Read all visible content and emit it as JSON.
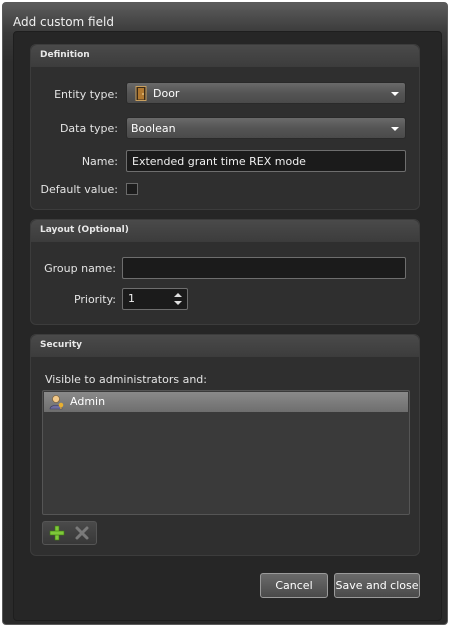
{
  "window": {
    "title": "Add custom field"
  },
  "definition": {
    "header": "Definition",
    "entity_type": {
      "label": "Entity type:",
      "value": "Door",
      "icon": "door-icon"
    },
    "data_type": {
      "label": "Data type:",
      "value": "Boolean"
    },
    "name": {
      "label": "Name:",
      "value": "Extended grant time REX mode"
    },
    "default_value": {
      "label": "Default value:",
      "checked": false
    }
  },
  "layout": {
    "header": "Layout (Optional)",
    "group_name": {
      "label": "Group name:",
      "value": ""
    },
    "priority": {
      "label": "Priority:",
      "value": "1"
    }
  },
  "security": {
    "header": "Security",
    "visible_label": "Visible to administrators and:",
    "users": [
      {
        "name": "Admin",
        "icon": "admin-user-icon"
      }
    ],
    "toolbar": {
      "add_icon": "add-icon",
      "remove_icon": "remove-icon"
    }
  },
  "buttons": {
    "cancel": "Cancel",
    "save_close": "Save and close"
  }
}
